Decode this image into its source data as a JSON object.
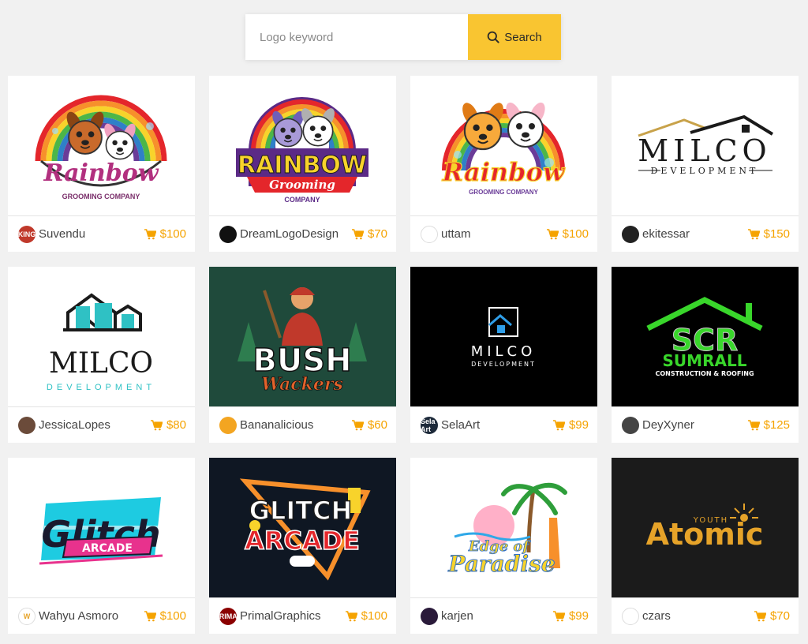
{
  "search": {
    "placeholder": "Logo keyword",
    "button_label": "Search"
  },
  "colors": {
    "accent": "#f9c531",
    "price": "#f5a300",
    "background": "#f1f1f1"
  },
  "logos": [
    {
      "art": "rainbow-pet",
      "title": "Rainbow",
      "sub": "GROOMING COMPANY",
      "bg": "#ffffff",
      "designer": "Suvendu",
      "avatar_bg": "#c0392b",
      "avatar_text": "KING",
      "price": "$100"
    },
    {
      "art": "rainbow-grooming",
      "title": "RAINBOW",
      "title2": "Grooming",
      "sub": "COMPANY",
      "bg": "#ffffff",
      "designer": "DreamLogoDesign",
      "avatar_bg": "#111111",
      "avatar_text": "",
      "price": "$70"
    },
    {
      "art": "rainbow-bunny",
      "title": "Rainbow",
      "sub": "GROOMING COMPANY",
      "bg": "#ffffff",
      "designer": "uttam",
      "avatar_bg": "#ffffff",
      "avatar_text": "",
      "price": "$100"
    },
    {
      "art": "milco-roof",
      "title": "MILCO",
      "sub": "DEVELOPMENT",
      "bg": "#ffffff",
      "designer": "ekitessar",
      "avatar_bg": "#222222",
      "avatar_text": "",
      "price": "$150"
    },
    {
      "art": "milco-houses",
      "title": "MILCO",
      "sub": "DEVELOPMENT",
      "bg": "#ffffff",
      "designer": "JessicaLopes",
      "avatar_bg": "#6b4b3a",
      "avatar_text": "",
      "price": "$80"
    },
    {
      "art": "bush-wackers",
      "title": "BUSH",
      "sub": "Wackers",
      "bg": "#1f4a3b",
      "designer": "Bananalicious",
      "avatar_bg": "#f3a521",
      "avatar_text": "",
      "price": "$60"
    },
    {
      "art": "milco-dark",
      "title": "MILCO",
      "sub": "DEVELOPMENT",
      "bg": "#000000",
      "designer": "SelaArt",
      "avatar_bg": "#1d2a3a",
      "avatar_text": "Sela Art",
      "price": "$99"
    },
    {
      "art": "sumrall",
      "title": "SUMRALL",
      "sub": "CONSTRUCTION & ROOFING",
      "mono": "SCR",
      "bg": "#000000",
      "designer": "DeyXyner",
      "avatar_bg": "#444444",
      "avatar_text": "",
      "price": "$125"
    },
    {
      "art": "glitch-cyan",
      "title": "Glitch",
      "sub": "ARCADE",
      "bg": "#ffffff",
      "designer": "Wahyu Asmoro",
      "avatar_bg": "#ffffff",
      "avatar_text": "W",
      "price": "$100"
    },
    {
      "art": "glitch-arcade",
      "title": "GLITCH",
      "sub": "ARCADE",
      "bg": "#0f1723",
      "designer": "PrimalGraphics",
      "avatar_bg": "#8b0000",
      "avatar_text": "PRIMAL",
      "price": "$100"
    },
    {
      "art": "paradise",
      "title": "Edge of",
      "sub": "Paradise",
      "bg": "#ffffff",
      "designer": "karjen",
      "avatar_bg": "#2a1a3a",
      "avatar_text": "",
      "price": "$99"
    },
    {
      "art": "atomic",
      "title": "Atomic",
      "sub": "YOUTH",
      "bg": "#1b1b1b",
      "designer": "czars",
      "avatar_bg": "#ffffff",
      "avatar_text": "",
      "price": "$70"
    }
  ]
}
